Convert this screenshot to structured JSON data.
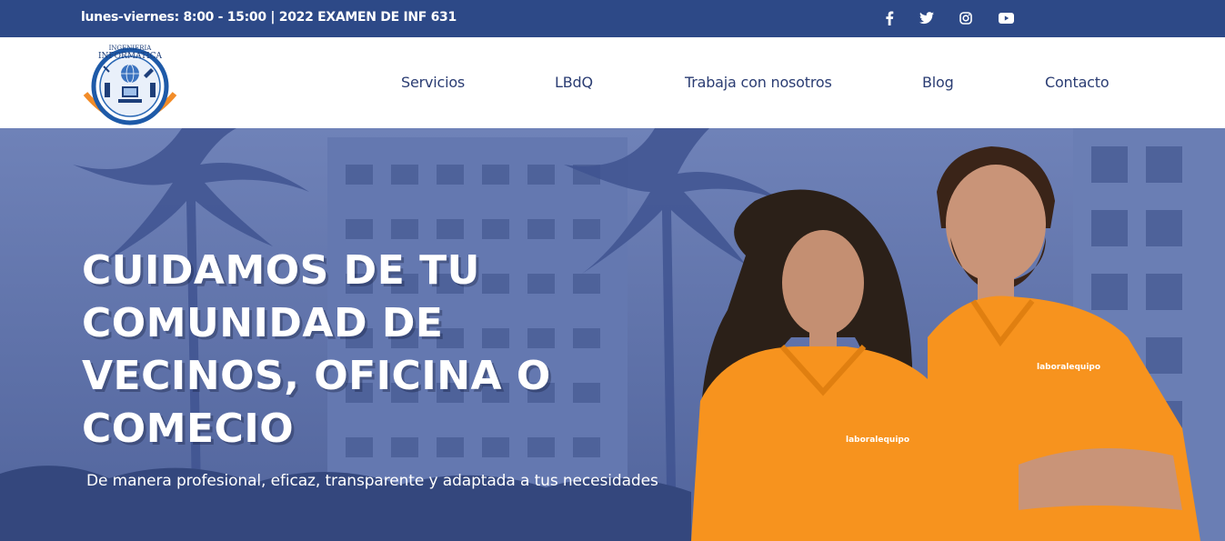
{
  "topbar": {
    "info": "lunes-viernes: 8:00 - 15:00 | 2022 EXAMEN DE INF 631",
    "social": [
      "facebook-icon",
      "twitter-icon",
      "instagram-icon",
      "youtube-icon"
    ]
  },
  "header": {
    "logo": {
      "line1": "INGENIERIA",
      "line2": "INFORMATICA"
    },
    "nav": [
      "Servicios",
      "LBdQ",
      "Trabaja con nosotros",
      "Blog",
      "Contacto"
    ]
  },
  "hero": {
    "title_lines": [
      "CUIDAMOS DE TU",
      "COMUNIDAD DE",
      "VECINOS, OFICINA O",
      "COMECIO"
    ],
    "subtitle": "De manera profesional, eficaz, transparente y adaptada a tus necesidades",
    "shirt_logo": "laboralequipo"
  },
  "colors": {
    "topbar": "#2d4987",
    "nav_text": "#2b3d73",
    "hero_tint": "#5a6ea8",
    "shirt": "#f7931e"
  }
}
